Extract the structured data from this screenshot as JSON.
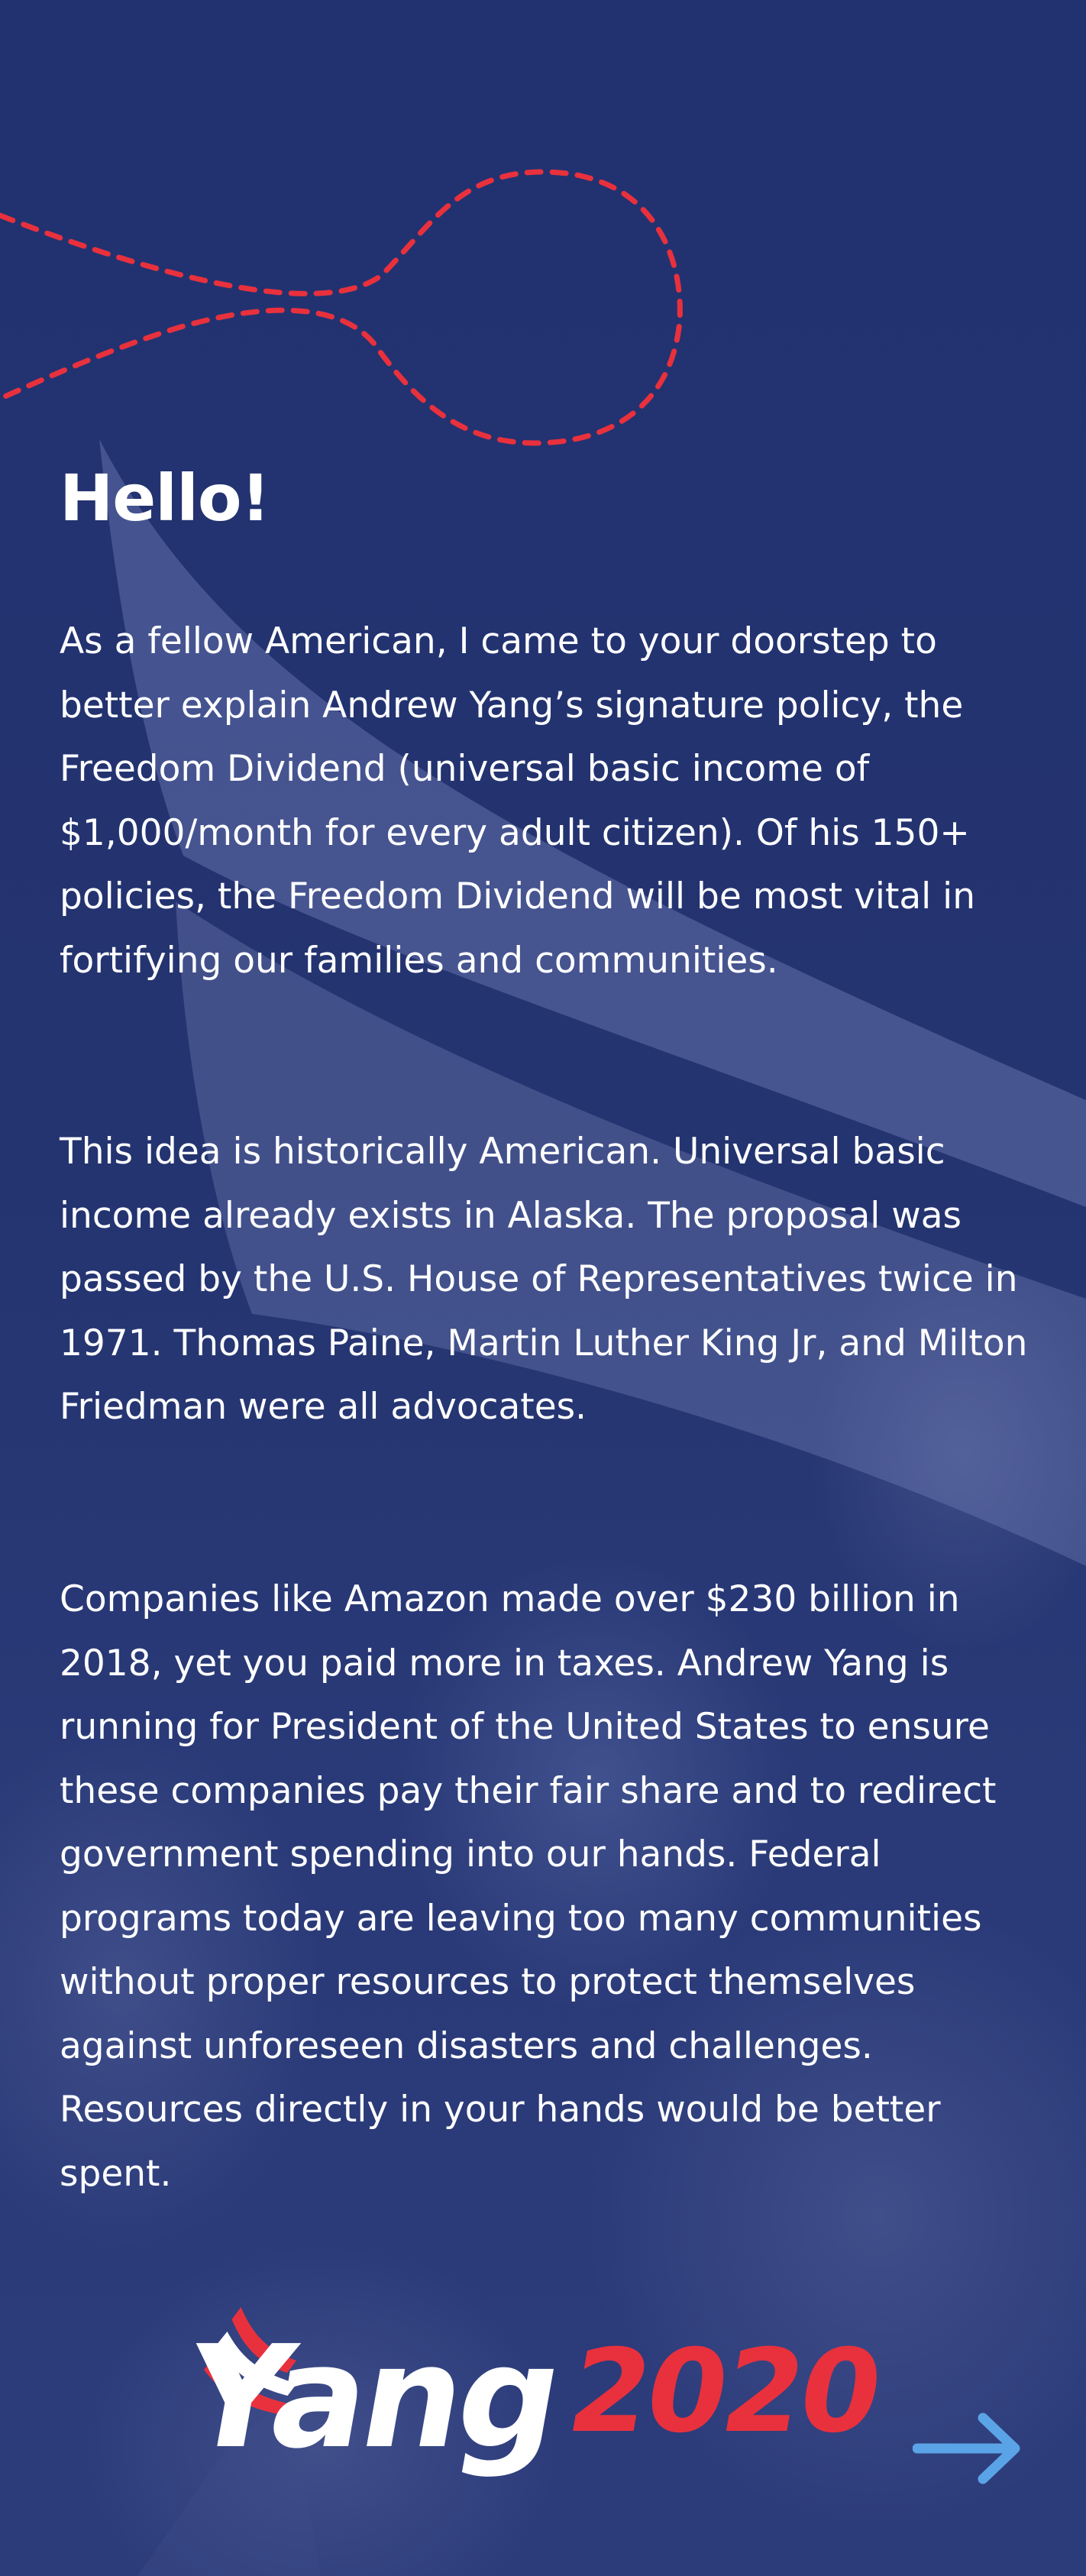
{
  "heading": "Hello!",
  "paragraphs": [
    "As a fellow American, I came to your doorstep to better explain Andrew Yang’s signature policy, the Freedom Dividend (universal basic income of $1,000/month for every adult citizen). Of his 150+ policies, the Freedom Dividend will be most vital in fortifying our families and communities.",
    "This idea is historically American. Universal basic income already exists in Alaska. The proposal was passed by the U.S. House of Representatives twice in 1971. Thomas Paine, Martin Luther King Jr, and Milton Friedman were all advocates.",
    "Companies like Amazon made over $230 billion in 2018, yet you paid more in taxes. Andrew Yang is running for President of the United States to ensure these companies pay their fair share and to redirect government spending into our hands. Federal programs today are leaving too many communities without proper resources to protect themselves against unforeseen disasters and challenges. Resources directly in your hands would be better spent."
  ],
  "logo": {
    "name": "Yang",
    "year": "2020"
  },
  "icons": {
    "next": "arrow-right-icon",
    "logo_flag": "flag-stripes-icon",
    "decoration": "dashed-loop-icon"
  },
  "colors": {
    "background": "#24336f",
    "accent_red": "#e8313d",
    "arrow_blue": "#5aa3e6",
    "text": "#ffffff"
  }
}
